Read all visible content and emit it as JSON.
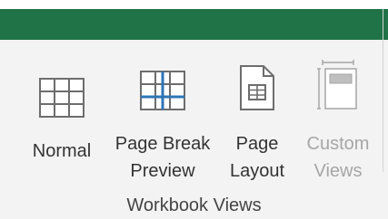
{
  "ribbon": {
    "group_label": "Workbook Views",
    "buttons": [
      {
        "id": "normal",
        "label": "Normal",
        "icon": "normal-view-icon",
        "enabled": true
      },
      {
        "id": "page_break",
        "label": "Page Break\nPreview",
        "icon": "page-break-preview-icon",
        "enabled": true
      },
      {
        "id": "page_layout",
        "label": "Page\nLayout",
        "icon": "page-layout-icon",
        "enabled": true
      },
      {
        "id": "custom",
        "label": "Custom\nViews",
        "icon": "custom-views-icon",
        "enabled": false
      }
    ]
  },
  "colors": {
    "title_bar": "#207346",
    "accent_blue": "#2e75b6",
    "icon_gray": "#6d6d6d",
    "disabled_gray": "#a6a6a6"
  }
}
